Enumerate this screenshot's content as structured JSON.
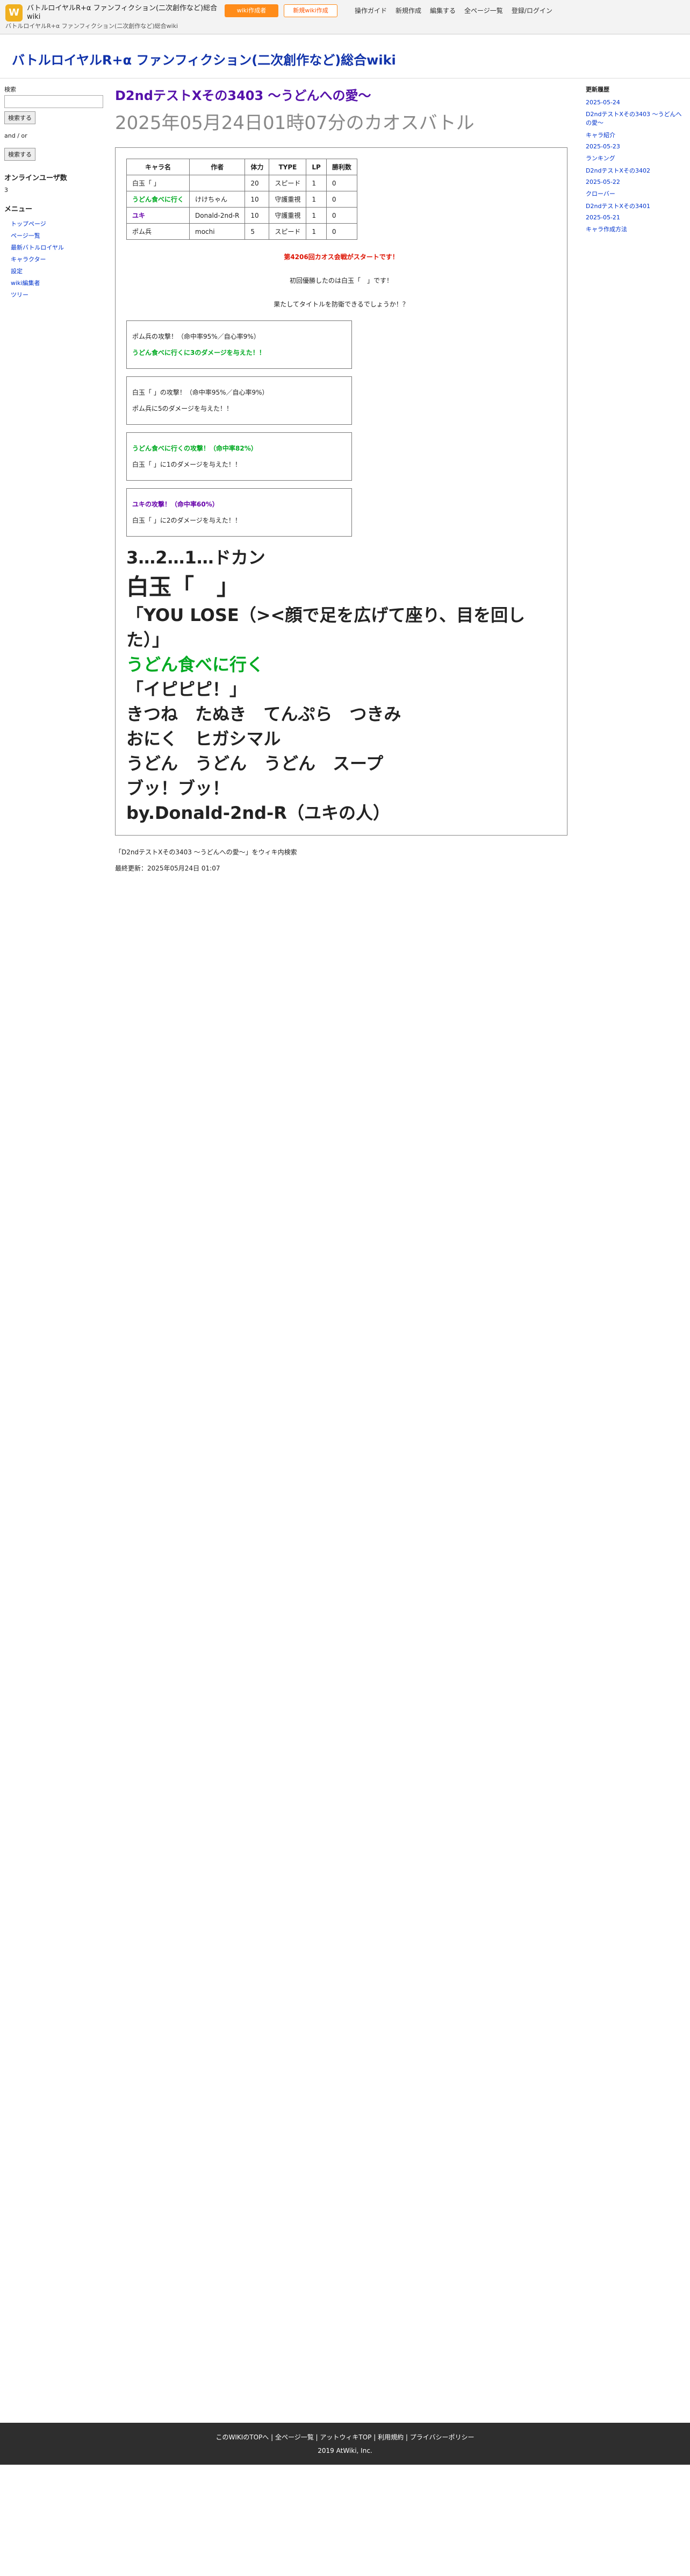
{
  "header": {
    "site_name": "バトルロイヤルR+α ファンフィクション(二次創作など)総合wiki",
    "site_sub": "バトルロイヤルR+α ファンフィクション(二次創作など)総合wiki",
    "version_button": "wiki作成者",
    "new_wiki_button": "新規wiki作成",
    "nav": [
      "操作ガイド",
      "新規作成",
      "編集する",
      "全ページ一覧",
      "登録/ログイン"
    ]
  },
  "site_title": "バトルロイヤルR+α ファンフィクション(二次創作など)総合wiki",
  "left": {
    "search_label": "検索",
    "search_placeholder": "",
    "search_button": "検索する",
    "and": "and",
    "or": "or",
    "search_button2": "検索する",
    "online_label": "オンラインユーザ数",
    "online_count": "3",
    "menu_title": "メニュー",
    "menu": [
      "トップページ",
      "ページ一覧",
      "最新バトルロイヤル",
      "キャラクター",
      "設定",
      "wiki編集者",
      "ツリー"
    ]
  },
  "article": {
    "title": "D2ndテストXその3403 ～うどんへの愛～",
    "subtitle": "2025年05月24日01時07分のカオスバトル",
    "table": {
      "headers": [
        "キャラ名",
        "作者",
        "体力",
        "TYPE",
        "LP",
        "勝利数"
      ],
      "rows": [
        [
          "白玉「 」",
          "",
          "20",
          "スピード",
          "1",
          "0"
        ],
        [
          "うどん食べに行く",
          "けけちゃん",
          "10",
          "守護重視",
          "1",
          "0"
        ],
        [
          "ユキ",
          "Donald-2nd-R",
          "10",
          "守護重視",
          "1",
          "0"
        ],
        [
          "ポム兵",
          "mochi",
          "5",
          "スピード",
          "1",
          "0"
        ]
      ]
    },
    "notice1": "第4206回カオス会戦がスタートです！",
    "notice2": "初回優勝したのは白玉「　」です！",
    "notice3": "果たしてタイトルを防衛できるでしょうか！？",
    "battles": [
      {
        "actor": "ポム兵",
        "line": "ポム兵の攻撃！（命中率95%／自心率9%）",
        "damage": "うどん食べに行くに3のダメージを与えた！！"
      },
      {
        "actor": "白玉「 」",
        "line": "白玉「 」の攻撃！（命中率95%／自心率9%）",
        "damage": "ポム兵に5のダメージを与えた！！"
      },
      {
        "actor": "うどん食べに行く",
        "line": "うどん食べに行くの攻撃！（命中率82%）",
        "damage": "白玉「 」に1のダメージを与えた！！"
      },
      {
        "actor": "ユキ",
        "line": "ユキの攻撃！（命中率60%）",
        "damage": "白玉「 」に2のダメージを与えた！！"
      }
    ],
    "final_title": "3…2…1…ドカン",
    "final_name": "白玉「　」",
    "big_line1": "「YOU LOSE（><顔で足を広げて座り、目を回した）」",
    "big_line2": "うどん食べに行く",
    "big_line3": "「イピピピ！」",
    "big_line4": "きつね　たぬき　てんぷら　つきみ",
    "big_line5": "おにく　ヒガシマル",
    "big_line6": "うどん　うどん　うどん　スープ",
    "big_line7": "ブッ！ブッ！",
    "big_line8": "by.Donald-2nd-R（ユキの人）",
    "breadcrumb": "「D2ndテストXその3403 ～うどんへの愛～」をウィキ内検索",
    "updated": "最終更新：2025年05月24日 01:07"
  },
  "right": {
    "title": "更新履歴",
    "items": [
      "2025-05-24",
      "D2ndテストXその3403 ～うどんへの愛～",
      "キャラ紹介",
      "2025-05-23",
      "ランキング",
      "D2ndテストXその3402",
      "2025-05-22",
      "クローバー",
      "D2ndテストXその3401",
      "2025-05-21",
      "キャラ作成方法"
    ]
  },
  "footer": {
    "links": [
      "このWIKIのTOPへ",
      "全ページ一覧",
      "アットウィキTOP",
      "利用規約",
      "プライバシーポリシー"
    ],
    "copyright": "2019 AtWiki, Inc."
  }
}
